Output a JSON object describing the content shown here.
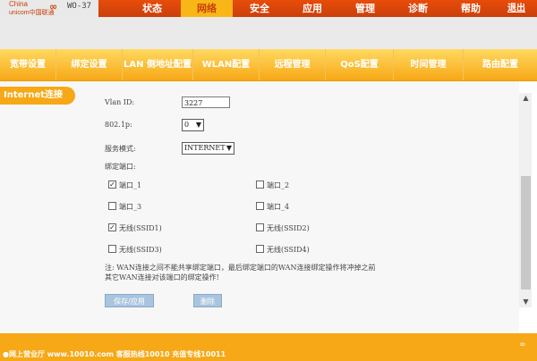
{
  "brand": {
    "logo_line1": "China",
    "logo_line2": "unicom中国联通",
    "model": "WO-37"
  },
  "main_nav": [
    {
      "label": "状态",
      "active": false
    },
    {
      "label": "网络",
      "active": true
    },
    {
      "label": "安全",
      "active": false
    },
    {
      "label": "应用",
      "active": false
    },
    {
      "label": "管理",
      "active": false
    },
    {
      "label": "诊断",
      "active": false
    },
    {
      "label": "帮助",
      "active": false
    }
  ],
  "logout_label": "退出",
  "sub_tabs": [
    "宽带设置",
    "绑定设置",
    "LAN 侧地址配置",
    "WLAN配置",
    "远程管理",
    "QoS配置",
    "时间管理",
    "路由配置"
  ],
  "section_tab": "Internet连接",
  "form": {
    "vlan_id_label": "Vlan ID:",
    "vlan_id_value": "3227",
    "priority_label": "802.1p:",
    "priority_value": "0",
    "service_mode_label": "服务模式:",
    "service_mode_value": "INTERNET",
    "bind_ports_label": "绑定端口:",
    "ports": [
      {
        "label": "端口_1",
        "checked": true
      },
      {
        "label": "端口_2",
        "checked": false
      },
      {
        "label": "端口_3",
        "checked": false
      },
      {
        "label": "端口_4",
        "checked": false
      },
      {
        "label": "无线(SSID1)",
        "checked": true
      },
      {
        "label": "无线(SSID2)",
        "checked": false
      },
      {
        "label": "无线(SSID3)",
        "checked": false
      },
      {
        "label": "无线(SSID4)",
        "checked": false
      }
    ],
    "note_line1": "注: WAN连接之间不能共享绑定端口，最后绑定端口的WAN连接绑定操作将冲掉之前",
    "note_line2": "其它WAN连接对该端口的绑定操作!",
    "save_label": "保存/应用",
    "delete_label": "删除"
  },
  "footer": {
    "text": "●网上营业厅 www.10010.com  客服热线10010  充值专线10011"
  },
  "colors": {
    "header_orange": "#e84c0a",
    "tab_yellow": "#f7a816",
    "button_blue": "#a9c4de"
  }
}
